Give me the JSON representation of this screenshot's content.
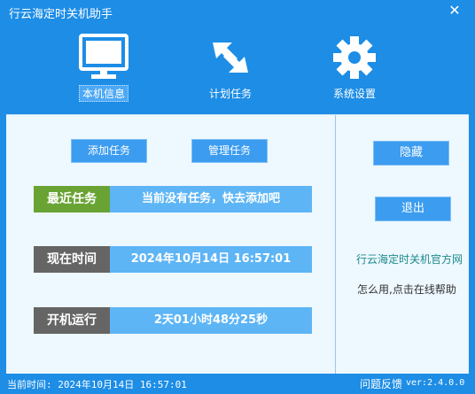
{
  "window": {
    "title": "行云海定时关机助手",
    "close_glyph": "✕"
  },
  "tabs": [
    {
      "label": "本机信息",
      "icon": "monitor-icon",
      "active": true
    },
    {
      "label": "计划任务",
      "icon": "arrows-icon",
      "active": false
    },
    {
      "label": "系统设置",
      "icon": "gear-icon",
      "active": false
    }
  ],
  "actions": {
    "add_task": "添加任务",
    "manage_tasks": "管理任务"
  },
  "info": {
    "recent": {
      "label": "最近任务",
      "value": "当前没有任务，快去添加吧"
    },
    "now": {
      "label": "现在时间",
      "value": "2024年10月14日  16:57:01"
    },
    "uptime": {
      "label": "开机运行",
      "value": "2天01小时48分25秒"
    }
  },
  "side": {
    "hide": "隐藏",
    "exit": "退出",
    "website": "行云海定时关机官方网",
    "help": "怎么用,点击在线帮助"
  },
  "status": {
    "current_time": "当前时间: 2024年10月14日 16:57:01",
    "feedback": "问题反馈",
    "version": "ver:2.4.0.0"
  },
  "colors": {
    "window_bg": "#1d8de6",
    "content_bg": "#eef8ff",
    "button_bg": "#3b9cf0",
    "value_bg": "#5db5f5",
    "recent_label_bg": "#69a334",
    "dark_label_bg": "#656565",
    "link": "#1a8a8a"
  }
}
